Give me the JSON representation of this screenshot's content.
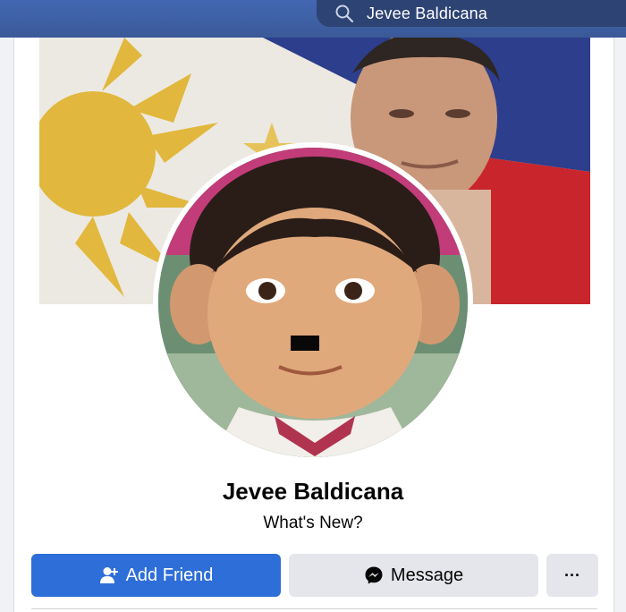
{
  "search": {
    "query": "Jevee Baldicana"
  },
  "profile": {
    "name": "Jevee Baldicana",
    "subtitle": "What's New?"
  },
  "actions": {
    "add_friend": "Add Friend",
    "message": "Message",
    "more": "···"
  },
  "colors": {
    "topbar": "#3b5998",
    "primary_button": "#2d6ed8",
    "secondary_button": "#e4e6eb"
  },
  "icons": {
    "search": "search-icon",
    "add_friend": "add-friend-icon",
    "message": "messenger-icon",
    "more": "more-icon"
  }
}
